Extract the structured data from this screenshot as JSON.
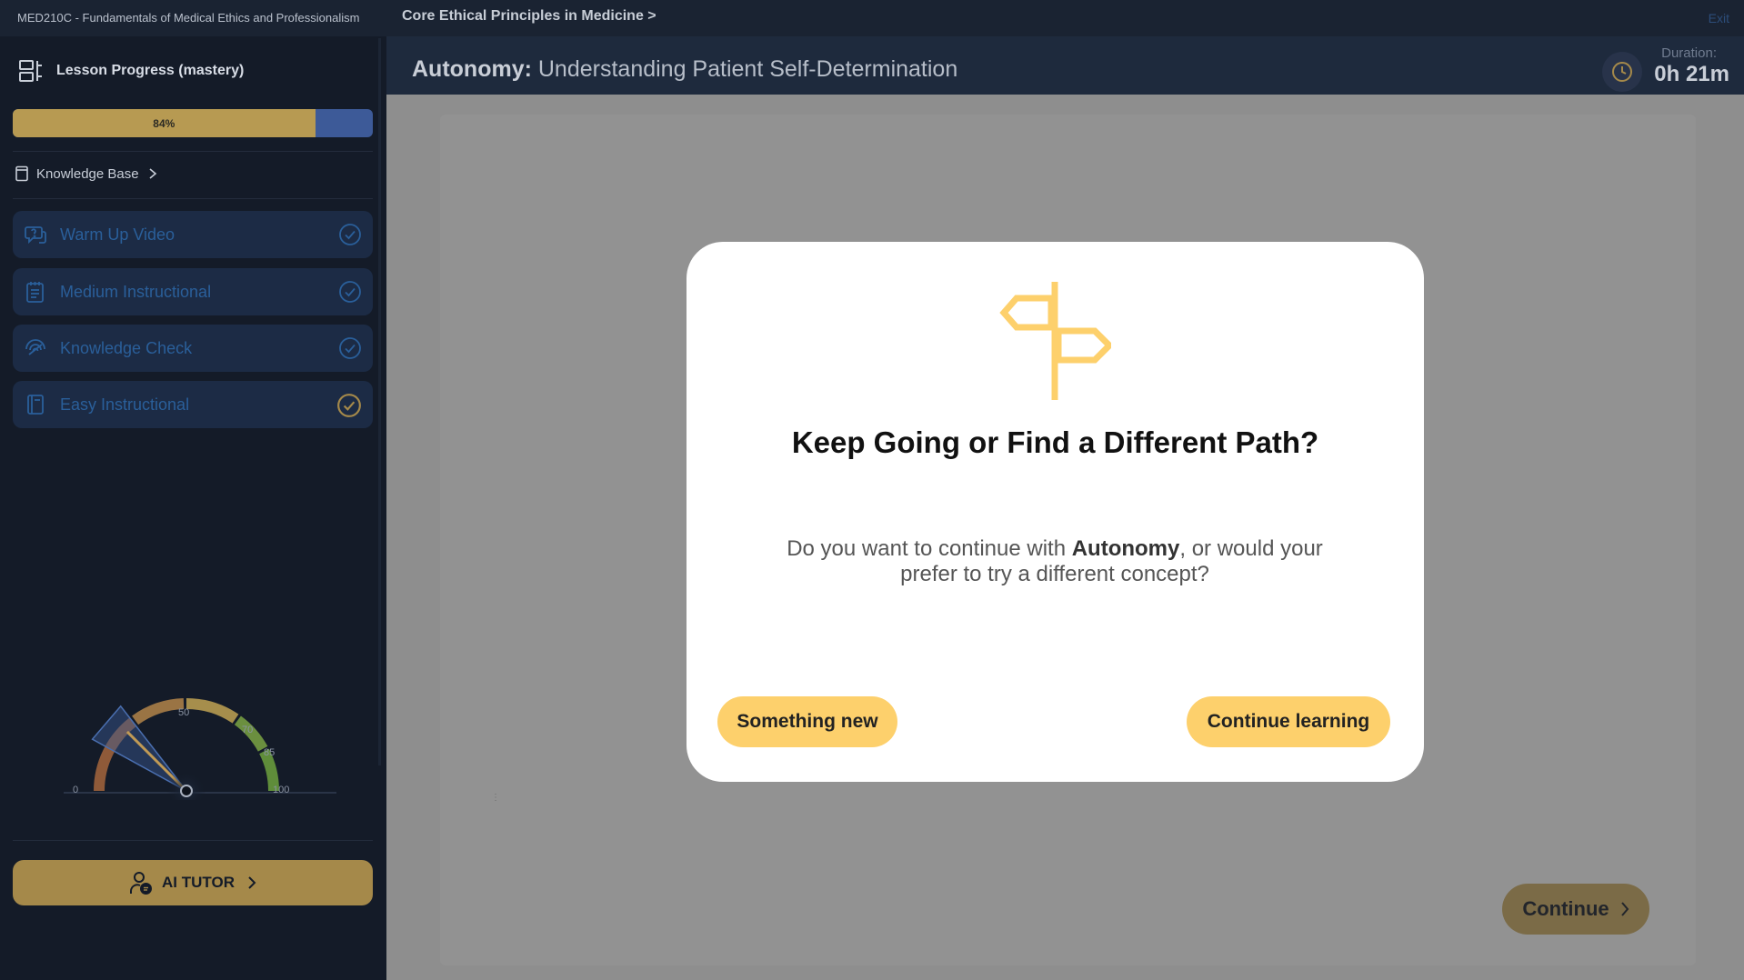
{
  "course": {
    "title": "MED210C - Fundamentals of Medical Ethics and Professionalism"
  },
  "sidebar": {
    "progress_label": "Lesson Progress (mastery)",
    "progress_value": 84,
    "progress_text": "84%",
    "knowledge_base": "Knowledge Base",
    "lessons": [
      {
        "label": "Warm Up Video",
        "icon": "video-question-icon",
        "status": "completed"
      },
      {
        "label": "Medium Instructional",
        "icon": "document-icon",
        "status": "completed"
      },
      {
        "label": "Knowledge Check",
        "icon": "signal-icon",
        "status": "completed"
      },
      {
        "label": "Easy Instructional",
        "icon": "book-icon",
        "status": "current"
      }
    ],
    "gauge": {
      "value": 25,
      "ticks": [
        "0",
        "50",
        "70",
        "85",
        "100"
      ]
    },
    "tutor_label": "AI TUTOR"
  },
  "header": {
    "breadcrumb": "Core Ethical Principles in Medicine >",
    "exit_label": "Exit",
    "lesson_concept": "Autonomy:",
    "lesson_title": "Understanding Patient Self-Determination",
    "duration_label": "Duration:",
    "duration_value": "0h 21m"
  },
  "content": {
    "continue_label": "Continue",
    "dots": "⋮"
  },
  "modal": {
    "title": "Keep Going or Find a Different Path?",
    "text_before": "Do you want to continue with ",
    "text_concept": "Autonomy",
    "text_after": ", or would your prefer to try a different concept?",
    "btn_new": "Something new",
    "btn_continue": "Continue learning"
  },
  "colors": {
    "accent_gold": "#fdd06c",
    "progress_fill": "#b79a52",
    "progress_track": "#3d5a98",
    "sidebar_bg": "#141b28",
    "lesson_item_bg": "#1c2b45",
    "lesson_text": "#2a5f9a"
  }
}
